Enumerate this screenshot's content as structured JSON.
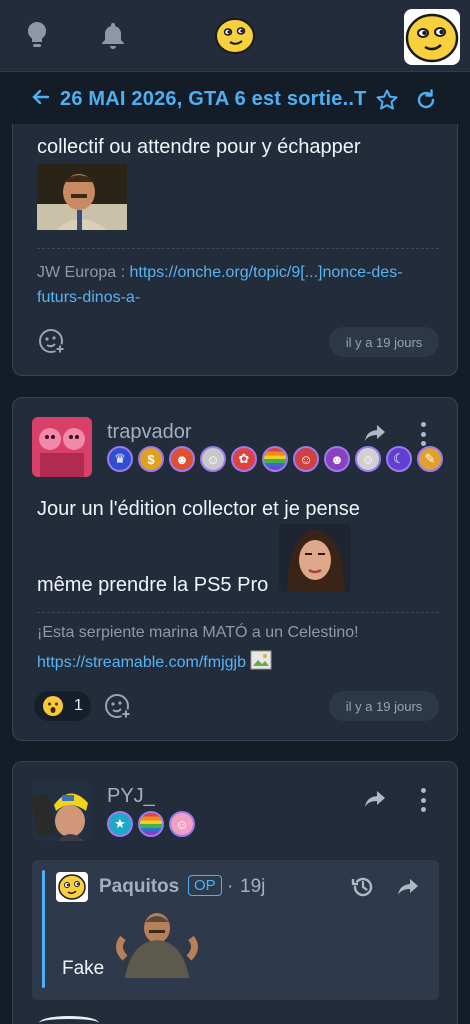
{
  "topbar": {
    "icons": [
      "lightbulb-icon",
      "bell-icon",
      "smiley-logo-icon",
      "user-avatar"
    ]
  },
  "topic": {
    "title": "26 MAI 2026, GTA 6 est sortie..T"
  },
  "post1": {
    "text_partial": "collectif ou attendre pour y échapper",
    "signature_prefix": "JW Europa : ",
    "signature_link": "https://onche.org/topic/9[...]nonce-des-futurs-dinos-a-",
    "time": "il y a 19 jours"
  },
  "post2": {
    "username": "trapvador",
    "text_line1": "Jour un l'édition collector et je pense",
    "text_line2": "même prendre la PS5 Pro",
    "signature_text": "¡Esta serpiente marina MATÓ a un Celestino!",
    "signature_link": "https://streamable.com/fmjgjb",
    "reaction_count": "1",
    "time": "il y a 19 jours",
    "badge_colors": [
      "#2f4fd0",
      "#e0a020",
      "#e05030",
      "#c8c8c8",
      "#e04040",
      "#4ac060",
      "#d04040",
      "#8a40c0",
      "#d0d0d0",
      "#6040d0",
      "#e0a030",
      "#3060c0"
    ]
  },
  "post3": {
    "username": "PYJ_",
    "quote": {
      "username": "Paquitos",
      "op_label": "OP",
      "time": "19j",
      "text": "Fake"
    }
  },
  "colors": {
    "accent": "#4db0f5",
    "background": "#141c27",
    "card": "#222c3a"
  }
}
